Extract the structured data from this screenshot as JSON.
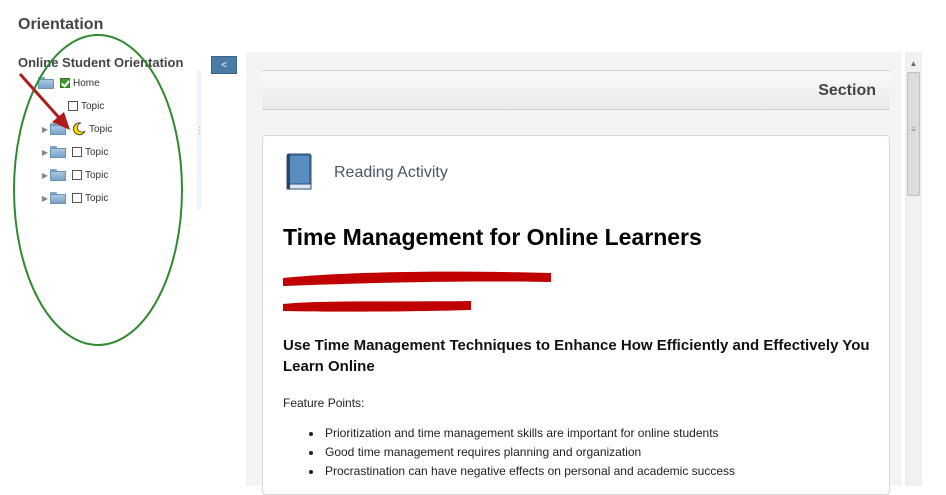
{
  "page": {
    "title": "Orientation"
  },
  "sidebar": {
    "title": "Online Student Orientation",
    "collapse_label": "<",
    "items": [
      {
        "label": "Home",
        "status": "completed"
      },
      {
        "label": "Topic",
        "status": "unchecked"
      },
      {
        "label": "Topic",
        "status": "in-progress"
      },
      {
        "label": "Topic",
        "status": "unchecked"
      },
      {
        "label": "Topic",
        "status": "unchecked"
      },
      {
        "label": "Topic",
        "status": "unchecked"
      }
    ]
  },
  "content": {
    "section_label": "Section",
    "activity_label": "Reading Activity",
    "title": "Time Management for Online Learners",
    "subheading": "Use Time Management Techniques to Enhance How Efficiently and Effectively You Learn Online",
    "feature_label": "Feature Points:",
    "feature_points": [
      "Prioritization and time management skills are important for online students",
      "Good time management requires planning and organization",
      "Procrastination can have negative effects on personal and academic success"
    ]
  },
  "icons": {
    "book": "book-icon",
    "folder": "folder-icon",
    "completed": "green-check-icon",
    "in_progress": "crescent-moon-icon"
  },
  "colors": {
    "accent": "#4a7ba7",
    "annotation_arrow": "#b01b1b",
    "annotation_ellipse": "#2e8b2e",
    "redaction": "#c00000"
  }
}
